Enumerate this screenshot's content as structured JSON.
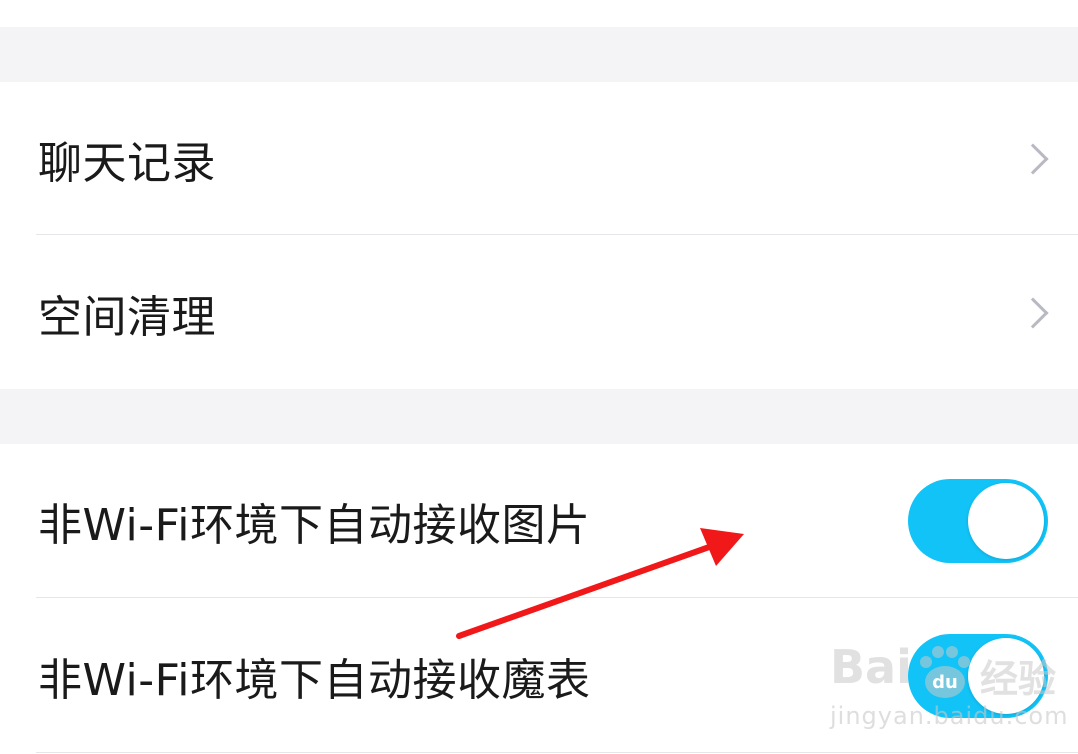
{
  "settings": {
    "items": [
      {
        "label": "聊天记录",
        "control": "chevron",
        "icon": "chevron-right-icon"
      },
      {
        "label": "空间清理",
        "control": "chevron",
        "icon": "chevron-right-icon"
      },
      {
        "label": "非Wi-Fi环境下自动接收图片",
        "control": "toggle",
        "on": true
      },
      {
        "label": "非Wi-Fi环境下自动接收魔表",
        "control": "toggle",
        "on": true
      }
    ]
  },
  "annotation": {
    "type": "red-arrow",
    "color": "#f01818",
    "points_to": "toggle-auto-receive-images"
  },
  "colors": {
    "toggle_on": "#12c3f7",
    "section_gap": "#f4f4f7",
    "chevron": "#b9b9c4",
    "text": "#1a1a1a"
  },
  "watermark": {
    "logo_text": "Bai",
    "logo_glyph": "du",
    "cn_text": "经验",
    "url": "jingyan.baidu.com"
  }
}
